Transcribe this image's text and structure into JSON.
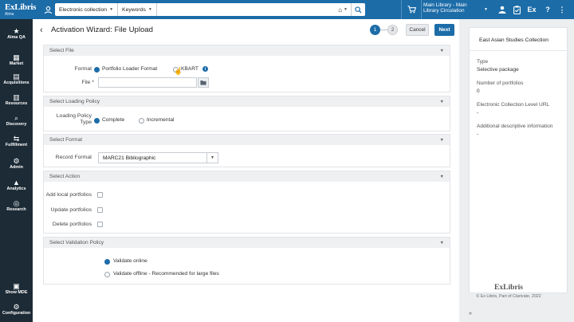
{
  "brand": {
    "logo_line1": "ExLibris",
    "logo_line2": "Alma"
  },
  "search": {
    "scope": "Electronic collection",
    "field": "Keywords",
    "value": ""
  },
  "header": {
    "location": "Main Library - Main Library Circulation",
    "ex_label": "Ex"
  },
  "nav": [
    {
      "label": "Alma QA",
      "icon": "★"
    },
    {
      "label": "Market",
      "icon": "▦"
    },
    {
      "label": "Acquisitions",
      "icon": "▤"
    },
    {
      "label": "Resources",
      "icon": "▥"
    },
    {
      "label": "Discovery",
      "icon": "⌕"
    },
    {
      "label": "Fulfillment",
      "icon": "⇆"
    },
    {
      "label": "Admin",
      "icon": "⚙"
    },
    {
      "label": "Analytics",
      "icon": "▲"
    },
    {
      "label": "Research",
      "icon": "◎"
    },
    {
      "label": "Show MDE",
      "icon": "▣"
    },
    {
      "label": "Configuration",
      "icon": "⚙"
    }
  ],
  "page": {
    "title": "Activation Wizard: File Upload",
    "steps": [
      "1",
      "2"
    ],
    "cancel_label": "Cancel",
    "next_label": "Next"
  },
  "sections": {
    "select_file": {
      "title": "Select File",
      "format_label": "Format",
      "format_options": [
        "Portfolio Loader Format",
        "KBART"
      ],
      "format_selected": "Portfolio Loader Format",
      "file_label": "File *",
      "file_value": ""
    },
    "loading_policy": {
      "title": "Select Loading Policy",
      "label": "Loading Policy Type",
      "options": [
        "Complete",
        "Incremental"
      ],
      "selected": "Complete"
    },
    "format": {
      "title": "Select Format",
      "record_format_label": "Record Format",
      "record_format_value": "MARC21 Bibliographic"
    },
    "action": {
      "title": "Select Action",
      "options": [
        {
          "label": "Add local portfolios",
          "checked": false
        },
        {
          "label": "Update portfolios",
          "checked": false
        },
        {
          "label": "Delete portfolios",
          "checked": false
        }
      ]
    },
    "validation": {
      "title": "Select Validation Policy",
      "options": [
        "Validate online",
        "Validate offline - Recommended for large files"
      ],
      "selected": "Validate online"
    }
  },
  "right_pane": {
    "title": "East Asian Studies Collection",
    "fields": [
      {
        "label": "Type",
        "value": "Selective package"
      },
      {
        "label": "Number of portfolios",
        "value": "0"
      },
      {
        "label": "Electronic Collection Level URL",
        "value": "-"
      },
      {
        "label": "Additional descriptive information",
        "value": "-"
      }
    ],
    "footer_logo": "ExLibris",
    "footer_copy": "© Ex Libris, Part of Clarivate,  2022"
  },
  "colors": {
    "brand_blue": "#1c6ca8",
    "nav_dark": "#1c2b36"
  }
}
